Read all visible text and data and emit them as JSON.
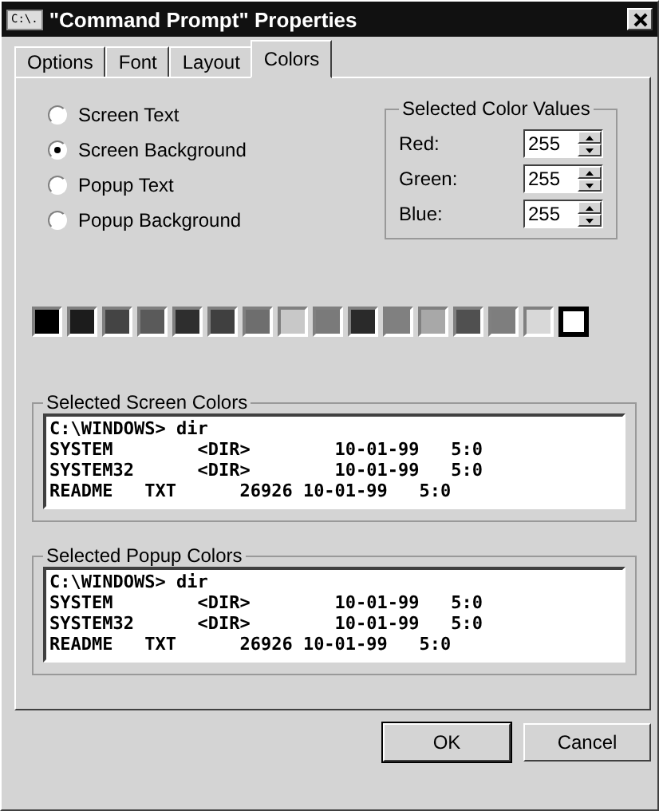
{
  "window": {
    "title": "\"Command Prompt\" Properties",
    "icon_text": "C:\\."
  },
  "tabs": [
    {
      "label": "Options",
      "selected": false
    },
    {
      "label": "Font",
      "selected": false
    },
    {
      "label": "Layout",
      "selected": false
    },
    {
      "label": "Colors",
      "selected": true
    }
  ],
  "targets": [
    {
      "label": "Screen Text",
      "selected": false
    },
    {
      "label": "Screen Background",
      "selected": true
    },
    {
      "label": "Popup Text",
      "selected": false
    },
    {
      "label": "Popup Background",
      "selected": false
    }
  ],
  "color_values": {
    "title": "Selected Color Values",
    "fields": [
      {
        "label": "Red:",
        "value": "255"
      },
      {
        "label": "Green:",
        "value": "255"
      },
      {
        "label": "Blue:",
        "value": "255"
      }
    ]
  },
  "palette": [
    {
      "color": "#000000",
      "selected": false
    },
    {
      "color": "#1c1c1c",
      "selected": false
    },
    {
      "color": "#444444",
      "selected": false
    },
    {
      "color": "#5a5a5a",
      "selected": false
    },
    {
      "color": "#2e2e2e",
      "selected": false
    },
    {
      "color": "#404040",
      "selected": false
    },
    {
      "color": "#6e6e6e",
      "selected": false
    },
    {
      "color": "#c8c8c8",
      "selected": false
    },
    {
      "color": "#7a7a7a",
      "selected": false
    },
    {
      "color": "#2a2a2a",
      "selected": false
    },
    {
      "color": "#808080",
      "selected": false
    },
    {
      "color": "#a8a8a8",
      "selected": false
    },
    {
      "color": "#505050",
      "selected": false
    },
    {
      "color": "#7e7e7e",
      "selected": false
    },
    {
      "color": "#d8d8d8",
      "selected": false
    },
    {
      "color": "#ffffff",
      "selected": true
    }
  ],
  "previews": [
    {
      "title": "Selected Screen Colors",
      "lines": [
        "C:\\WINDOWS> dir",
        "SYSTEM        <DIR>        10-01-99   5:0",
        "SYSTEM32      <DIR>        10-01-99   5:0",
        "README   TXT      26926 10-01-99   5:0"
      ]
    },
    {
      "title": "Selected Popup Colors",
      "lines": [
        "C:\\WINDOWS> dir",
        "SYSTEM        <DIR>        10-01-99   5:0",
        "SYSTEM32      <DIR>        10-01-99   5:0",
        "README   TXT      26926 10-01-99   5:0"
      ]
    }
  ],
  "buttons": [
    {
      "label": "OK",
      "default": true
    },
    {
      "label": "Cancel",
      "default": false
    }
  ]
}
